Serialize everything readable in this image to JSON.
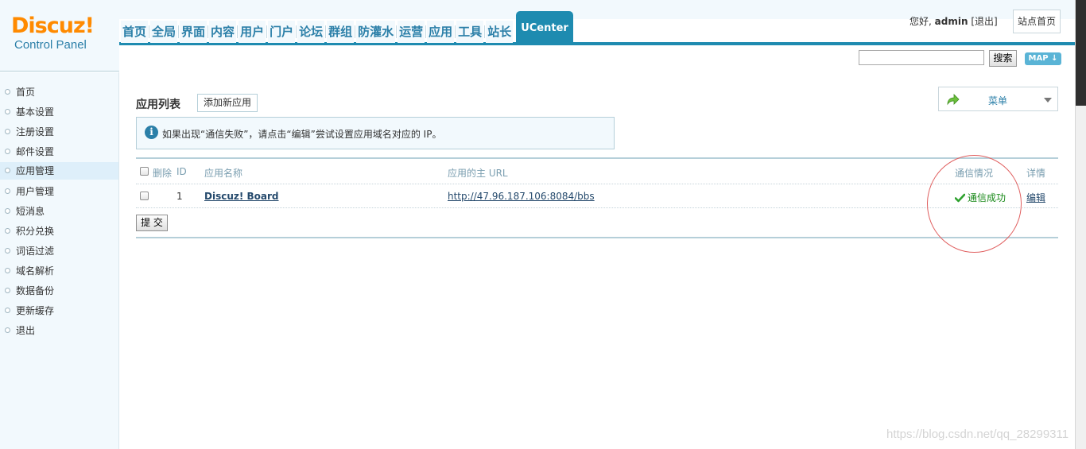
{
  "logo": {
    "brand": "Discuz!",
    "sub": "Control Panel"
  },
  "nav": {
    "items": [
      "首页",
      "全局",
      "界面",
      "内容",
      "用户",
      "门户",
      "论坛",
      "群组",
      "防灌水",
      "运营",
      "应用",
      "工具",
      "站长"
    ],
    "active": "UCenter"
  },
  "userbar": {
    "greeting": "您好,",
    "username": "admin",
    "logout": "[退出]",
    "site_home": "站点首页"
  },
  "search": {
    "value": "",
    "button": "搜索",
    "map": "MAP"
  },
  "sidebar": {
    "items": [
      {
        "label": "首页"
      },
      {
        "label": "基本设置"
      },
      {
        "label": "注册设置"
      },
      {
        "label": "邮件设置"
      },
      {
        "label": "应用管理"
      },
      {
        "label": "用户管理"
      },
      {
        "label": "短消息"
      },
      {
        "label": "积分兑换"
      },
      {
        "label": "词语过滤"
      },
      {
        "label": "域名解析"
      },
      {
        "label": "数据备份"
      },
      {
        "label": "更新缓存"
      },
      {
        "label": "退出"
      }
    ],
    "active_index": 4
  },
  "main": {
    "title": "应用列表",
    "add_button": "添加新应用",
    "notice": "如果出现“通信失败”，请点击“编辑”尝试设置应用域名对应的 IP。",
    "menu_label": "菜单",
    "table": {
      "headers": {
        "delete": "删除",
        "id": "ID",
        "name": "应用名称",
        "url": "应用的主 URL",
        "status": "通信情况",
        "detail": "详情"
      },
      "rows": [
        {
          "id": "1",
          "name": "Discuz! Board",
          "url": "http://47.96.187.106:8084/bbs",
          "status": "通信成功",
          "detail": "编辑"
        }
      ],
      "submit": "提 交"
    }
  },
  "watermark": "https://blog.csdn.net/qq_28299311",
  "colors": {
    "accent": "#1e8bb0",
    "nav_text": "#2b7fa8",
    "brand": "#ff8a00",
    "success": "#1b8a1b",
    "annotation": "#e06060"
  }
}
